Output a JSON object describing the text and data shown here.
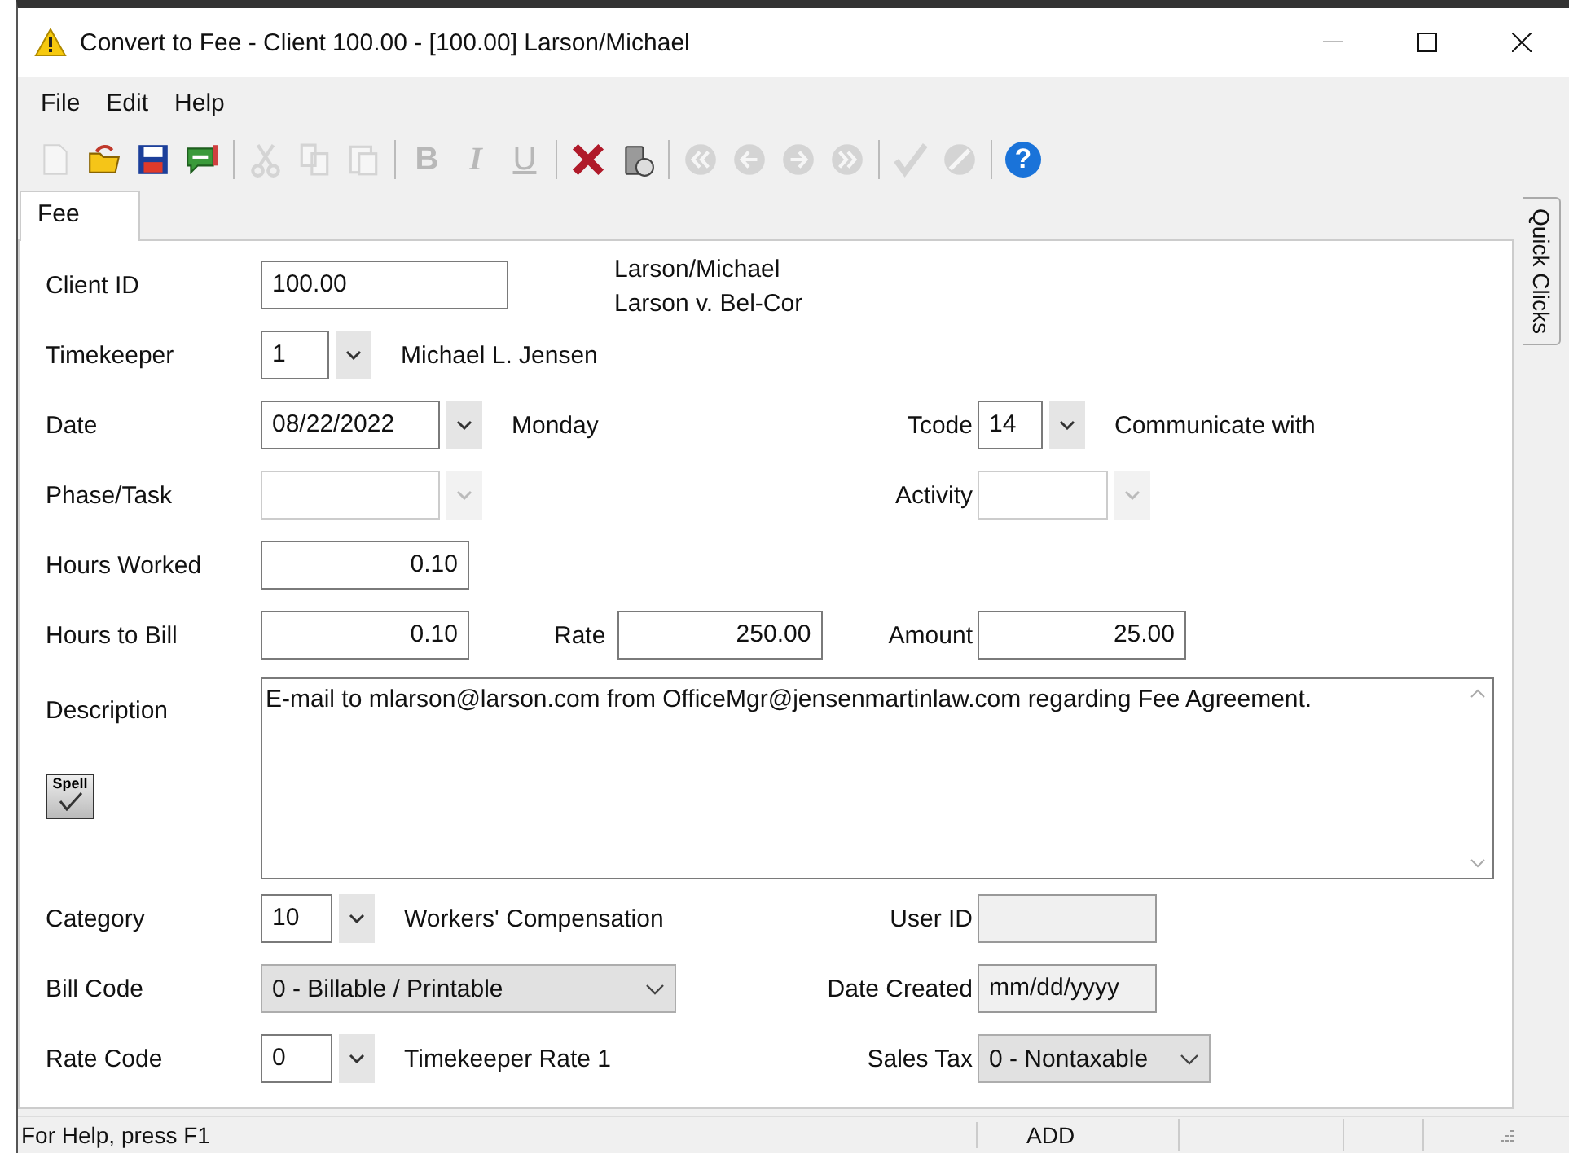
{
  "window": {
    "title": "Convert to Fee - Client 100.00 - [100.00] Larson/Michael"
  },
  "menu": [
    "File",
    "Edit",
    "Help"
  ],
  "toolbar_groups": [
    {
      "buttons": [
        {
          "kind": "new",
          "disabled": true
        },
        {
          "kind": "open",
          "disabled": false
        },
        {
          "kind": "save",
          "disabled": false
        },
        {
          "kind": "note",
          "disabled": false
        }
      ]
    },
    {
      "buttons": [
        {
          "kind": "cut",
          "disabled": true
        },
        {
          "kind": "copy",
          "disabled": true
        },
        {
          "kind": "paste",
          "disabled": true
        }
      ]
    },
    {
      "buttons": [
        {
          "kind": "bold",
          "glyph": "B",
          "disabled": true
        },
        {
          "kind": "italic",
          "glyph": "I",
          "disabled": true
        },
        {
          "kind": "underline",
          "glyph": "U",
          "disabled": true
        }
      ]
    },
    {
      "buttons": [
        {
          "kind": "delete",
          "disabled": false
        },
        {
          "kind": "trash",
          "disabled": false
        }
      ]
    },
    {
      "buttons": [
        {
          "kind": "first",
          "disabled": true
        },
        {
          "kind": "prev",
          "disabled": true
        },
        {
          "kind": "next",
          "disabled": true
        },
        {
          "kind": "last",
          "disabled": true
        }
      ]
    },
    {
      "buttons": [
        {
          "kind": "check",
          "disabled": true
        },
        {
          "kind": "cancel",
          "disabled": true
        }
      ]
    },
    {
      "buttons": [
        {
          "kind": "help",
          "glyph": "?",
          "disabled": false
        }
      ]
    }
  ],
  "tabs": [
    {
      "label": "Fee",
      "selected": true
    }
  ],
  "side_tab": "Quick Clicks",
  "client": {
    "label": "Client ID",
    "value": "100.00",
    "caption_lines": [
      "Larson/Michael",
      "Larson v. Bel-Cor"
    ]
  },
  "timekeeper": {
    "label": "Timekeeper",
    "value": "1",
    "caption": "Michael L. Jensen"
  },
  "date": {
    "label": "Date",
    "value": "08/22/2022",
    "caption": "Monday"
  },
  "tcode": {
    "label": "Tcode",
    "value": "14",
    "caption": "Communicate with"
  },
  "phase_task": {
    "label": "Phase/Task",
    "disabled": true
  },
  "activity": {
    "label": "Activity",
    "disabled": true
  },
  "hours_worked": {
    "label": "Hours Worked",
    "value": "0.10"
  },
  "hours_to_bill": {
    "label": "Hours to Bill",
    "value": "0.10"
  },
  "rate": {
    "label": "Rate",
    "value": "250.00"
  },
  "amount": {
    "label": "Amount",
    "value": "25.00"
  },
  "description": {
    "label": "Description",
    "value": "E-mail to mlarson@larson.com from OfficeMgr@jensenmartinlaw.com regarding Fee Agreement.",
    "spell_button": "Spell"
  },
  "category": {
    "label": "Category",
    "value": "10",
    "caption": "Workers' Compensation"
  },
  "user_id": {
    "label": "User ID",
    "read_only": true
  },
  "bill_code": {
    "label": "Bill Code",
    "value": "0 - Billable / Printable"
  },
  "date_created": {
    "label": "Date Created",
    "value": "mm/dd/yyyy",
    "read_only": true
  },
  "rate_code": {
    "label": "Rate Code",
    "value": "0",
    "caption": "Timekeeper Rate 1"
  },
  "sales_tax": {
    "label": "Sales Tax",
    "value": "0 - Nontaxable"
  },
  "status_bar": {
    "help": "For Help, press F1",
    "mode": "ADD"
  }
}
